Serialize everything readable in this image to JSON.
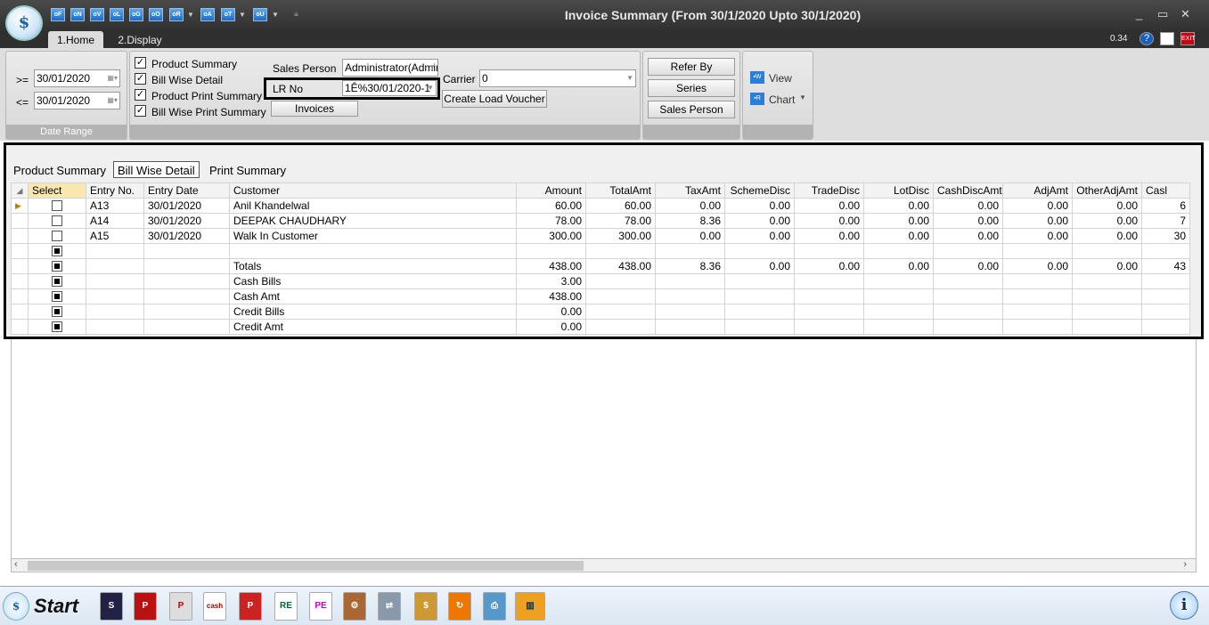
{
  "app": {
    "title": "Invoice Summary (From 30/1/2020 Upto 30/1/2020)",
    "version": "0.34",
    "quick_access": [
      "oF",
      "oN",
      "oV",
      "oL",
      "oG",
      "oO",
      "oR",
      "oA",
      "oT",
      "oU"
    ]
  },
  "tabs": {
    "home": "1.Home",
    "display": "2.Display"
  },
  "date_range": {
    "group_label": "Date Range",
    "from_op": ">=",
    "from_value": "30/01/2020",
    "to_op": "<=",
    "to_value": "30/01/2020"
  },
  "options": {
    "product_summary": "Product Summary",
    "bill_wise_detail": "Bill Wise Detail",
    "product_print_summary": "Product Print Summary",
    "bill_wise_print_summary": "Bill Wise Print Summary"
  },
  "filters": {
    "sales_person_label": "Sales Person",
    "sales_person_value": "Administrator(Admin",
    "lr_no_label": "LR No",
    "lr_no_value": "1Ê%30/01/2020-1",
    "carrier_label": "Carrier",
    "carrier_value": "0",
    "invoices_button": "Invoices",
    "create_load_voucher_button": "Create Load Voucher"
  },
  "group_by": {
    "refer_by": "Refer By",
    "series": "Series",
    "sales_person": "Sales Person"
  },
  "view": {
    "view": "View",
    "chart": "Chart"
  },
  "grid_tabs": [
    "Product Summary",
    "Bill Wise Detail",
    "Print Summary"
  ],
  "columns": [
    "Select",
    "Entry No.",
    "Entry Date",
    "Customer",
    "Amount",
    "TotalAmt",
    "TaxAmt",
    "SchemeDisc",
    "TradeDisc",
    "LotDisc",
    "CashDiscAmt",
    "AdjAmt",
    "OtherAdjAmt",
    "Casl"
  ],
  "rows": [
    {
      "entry": "A13",
      "date": "30/01/2020",
      "customer": "Anil Khandelwal",
      "amount": "60.00",
      "total": "60.00",
      "tax": "0.00",
      "scheme": "0.00",
      "trade": "0.00",
      "lot": "0.00",
      "cashdisc": "0.00",
      "adj": "0.00",
      "otheradj": "0.00",
      "cash": "6"
    },
    {
      "entry": "A14",
      "date": "30/01/2020",
      "customer": "DEEPAK CHAUDHARY",
      "amount": "78.00",
      "total": "78.00",
      "tax": "8.36",
      "scheme": "0.00",
      "trade": "0.00",
      "lot": "0.00",
      "cashdisc": "0.00",
      "adj": "0.00",
      "otheradj": "0.00",
      "cash": "7"
    },
    {
      "entry": "A15",
      "date": "30/01/2020",
      "customer": "Walk In Customer",
      "amount": "300.00",
      "total": "300.00",
      "tax": "0.00",
      "scheme": "0.00",
      "trade": "0.00",
      "lot": "0.00",
      "cashdisc": "0.00",
      "adj": "0.00",
      "otheradj": "0.00",
      "cash": "30"
    }
  ],
  "totals": {
    "label": "Totals",
    "amount": "438.00",
    "total": "438.00",
    "tax": "8.36",
    "scheme": "0.00",
    "trade": "0.00",
    "lot": "0.00",
    "cashdisc": "0.00",
    "adj": "0.00",
    "otheradj": "0.00",
    "cash": "43"
  },
  "summary": [
    {
      "label": "Cash Bills",
      "value": "3.00"
    },
    {
      "label": "Cash Amt",
      "value": "438.00"
    },
    {
      "label": "Credit Bills",
      "value": "0.00"
    },
    {
      "label": "Credit Amt",
      "value": "0.00"
    }
  ],
  "taskbar": {
    "start_label": "Start"
  }
}
